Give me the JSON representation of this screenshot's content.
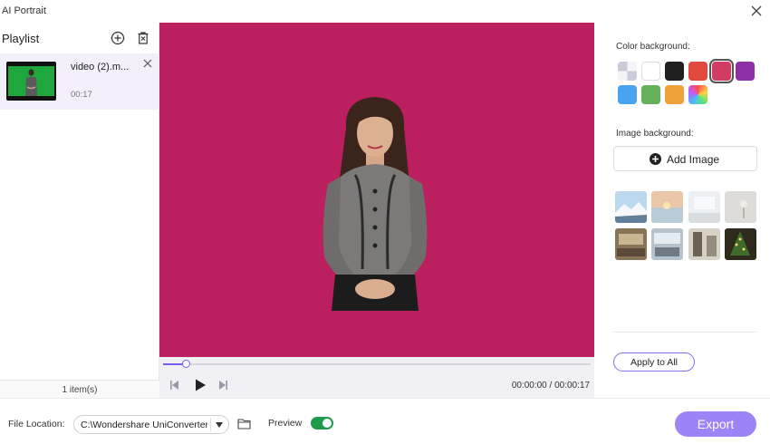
{
  "window": {
    "title": "AI Portrait",
    "close_icon": "close-icon"
  },
  "playlist": {
    "title": "Playlist",
    "items": [
      {
        "name": "video (2).m...",
        "duration": "00:17"
      }
    ],
    "count_label": "1 item(s)"
  },
  "player": {
    "timecode": "00:00:00 / 00:00:17",
    "progress_fraction": 0.055,
    "accent_color": "#7b5cf0"
  },
  "preview": {
    "background_color": "#bc1f5f"
  },
  "right_panel": {
    "color_bg_label": "Color background:",
    "swatches": [
      "transparent",
      "#ffffff",
      "#1f1f1f",
      "#e04a3c",
      "#d23b63",
      "#8d2fa6",
      "#4aa3ee",
      "#65b05a",
      "#f0a23a",
      "rainbow"
    ],
    "selected_swatch": 4,
    "image_bg_label": "Image background:",
    "add_image_label": "Add Image",
    "apply_all_label": "Apply to All"
  },
  "bottom": {
    "file_location_label": "File Location:",
    "file_location_value": "C:\\Wondershare UniConverter",
    "preview_label": "Preview",
    "preview_enabled": true,
    "export_label": "Export",
    "export_color": "#9d83f5",
    "toggle_color": "#1e9a4b"
  }
}
